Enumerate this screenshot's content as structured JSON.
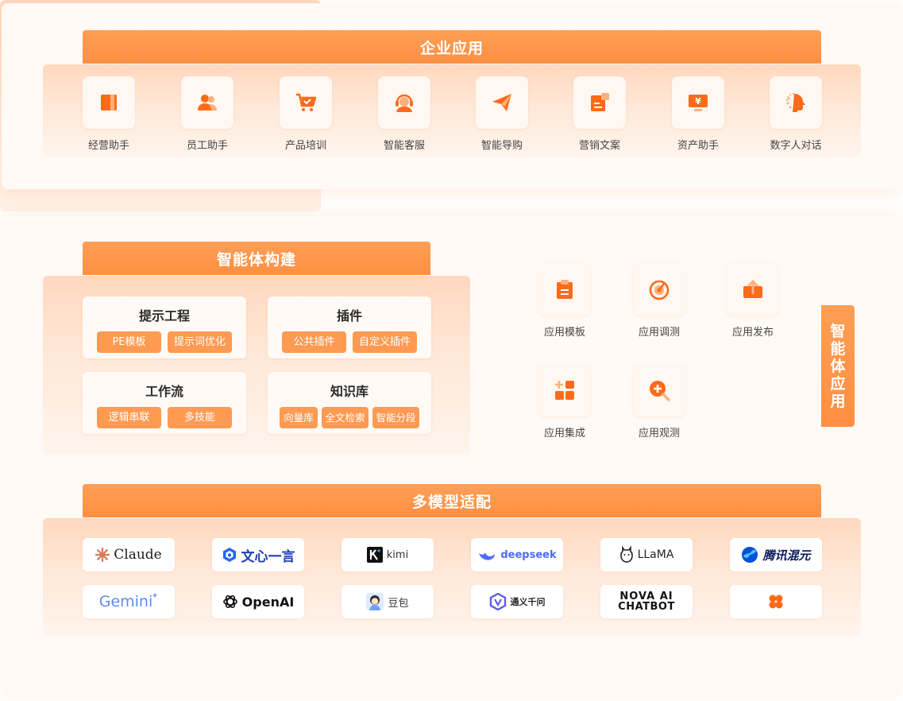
{
  "colors": {
    "accent": "#ff8f42",
    "band_light": "#ff9f55",
    "tray": "#ffe0cc",
    "tile": "#fff7f1"
  },
  "enterprise": {
    "title": "企业应用",
    "items": [
      {
        "label": "经营助手",
        "icon": "book-icon"
      },
      {
        "label": "员工助手",
        "icon": "users-icon"
      },
      {
        "label": "产品培训",
        "icon": "cart-icon"
      },
      {
        "label": "智能客服",
        "icon": "headset-icon"
      },
      {
        "label": "智能导购",
        "icon": "send-icon"
      },
      {
        "label": "营销文案",
        "icon": "document-icon"
      },
      {
        "label": "资产助手",
        "icon": "monitor-yen-icon"
      },
      {
        "label": "数字人对话",
        "icon": "digital-human-icon"
      }
    ],
    "yen_glyph": "¥"
  },
  "agent_build": {
    "title": "智能体构建",
    "cards": [
      {
        "title": "提示工程",
        "tags": [
          "PE模板",
          "提示词优化"
        ]
      },
      {
        "title": "插件",
        "tags": [
          "公共插件",
          "自定义插件"
        ]
      },
      {
        "title": "工作流",
        "tags": [
          "逻辑串联",
          "多技能"
        ]
      },
      {
        "title": "知识库",
        "tags": [
          "向量库",
          "全文检索",
          "智能分段"
        ]
      }
    ]
  },
  "app_mgmt": {
    "side_label": [
      "智",
      "能",
      "体",
      "应",
      "用"
    ],
    "items": [
      {
        "label": "应用模板",
        "icon": "clipboard-icon"
      },
      {
        "label": "应用调测",
        "icon": "target-icon"
      },
      {
        "label": "应用发布",
        "icon": "upload-icon"
      },
      {
        "label": "应用集成",
        "icon": "grid-plus-icon"
      },
      {
        "label": "应用观测",
        "icon": "magnify-plus-icon"
      }
    ]
  },
  "models": {
    "title": "多模型适配",
    "items": [
      {
        "label": "Claude",
        "icon": "claude-logo"
      },
      {
        "label": "文心一言",
        "icon": "wenxin-logo"
      },
      {
        "label": "kimi",
        "icon": "kimi-logo"
      },
      {
        "label": "deepseek",
        "icon": "deepseek-logo"
      },
      {
        "label": "LLaMA",
        "icon": "llama-logo"
      },
      {
        "label": "腾讯混元",
        "icon": "hunyuan-logo"
      },
      {
        "label": "Gemini",
        "icon": "gemini-logo"
      },
      {
        "label": "OpenAI",
        "icon": "openai-logo"
      },
      {
        "label": "豆包",
        "icon": "doubao-logo"
      },
      {
        "label": "通义千问",
        "icon": "tongyi-logo"
      },
      {
        "label": "NOVA AI",
        "label2": "CHATBOT",
        "icon": "nova-logo"
      },
      {
        "label": "",
        "icon": "clover-logo"
      }
    ]
  }
}
